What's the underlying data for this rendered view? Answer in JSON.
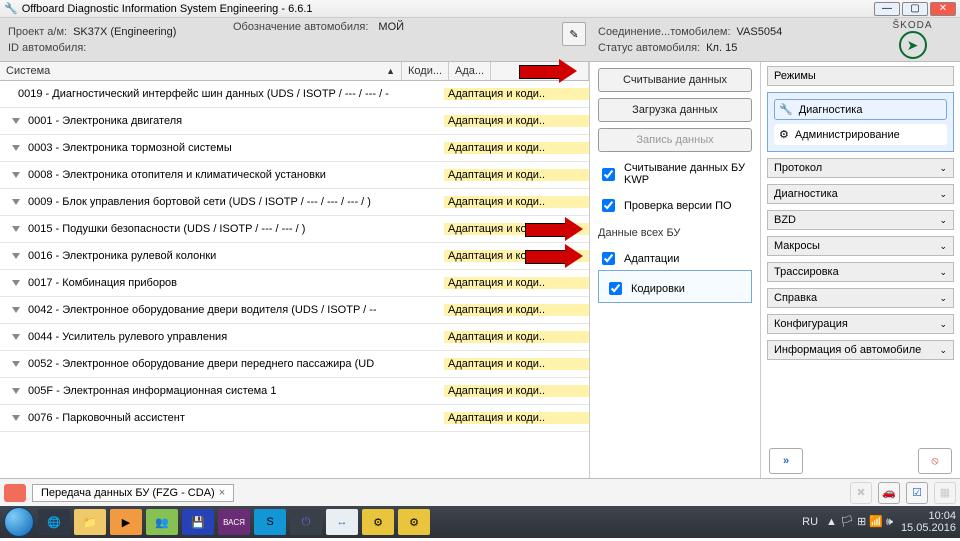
{
  "window": {
    "title": "Offboard Diagnostic Information System Engineering - 6.6.1",
    "min": "—",
    "max": "▢",
    "close": "✕"
  },
  "header": {
    "project_label": "Проект а/м:",
    "project_value": "SK37X      (Engineering)",
    "vehicle_id_label": "ID автомобиля:",
    "vehicle_id_value": "",
    "vehicle_alias_label": "Обозначение автомобиля:",
    "vehicle_alias_value": "МОЙ",
    "connection_label": "Соединение...томобилем:",
    "connection_value": "VAS5054",
    "status_label": "Статус автомобиля:",
    "status_value": "Кл. 15",
    "brand": "ŠKODA"
  },
  "table": {
    "col_system": "Система",
    "col_cod": "Коди...",
    "col_adp": "Ада...",
    "adapt_text": "Адаптация и коди..",
    "rows": [
      "0019 - Диагностический интерфейс шин данных  (UDS / ISOTP / --- / --- / -",
      "0001 - Электроника двигателя",
      "0003 - Электроника тормозной системы",
      "0008 - Электроника отопителя и климатической установки",
      "0009 - Блок управления бортовой сети  (UDS / ISOTP / --- / --- / --- /   )",
      "0015 - Подушки безопасности  (UDS / ISOTP / --- / --- /   )",
      "0016 - Электроника рулевой колонки",
      "0017 - Комбинация приборов",
      "0042 - Электронное оборудование двери водителя  (UDS / ISOTP / --",
      "0044 - Усилитель рулевого управления",
      "0052 - Электронное оборудование двери переднего пассажира  (UD",
      "005F - Электронная информационная система 1",
      "0076 - Парковочный ассистент"
    ]
  },
  "actions": {
    "read": "Считывание данных",
    "load": "Загрузка данных",
    "save": "Запись данных",
    "chk_kwp": "Считывание данных БУ KWP",
    "chk_ver": "Проверка версии ПО",
    "group_title": "Данные всех БУ",
    "chk_adapt": "Адаптации",
    "chk_code": "Кодировки"
  },
  "sidebar": {
    "modes_title": "Режимы",
    "diag": "Диагностика",
    "admin": "Администрирование",
    "sections": {
      "protocol": "Протокол",
      "diagnostics": "Диагностика",
      "bzd": "BZD",
      "macros": "Макросы",
      "trace": "Трассировка",
      "help": "Справка",
      "config": "Конфигурация",
      "vehicle_info": "Информация об автомобиле"
    }
  },
  "tabs": {
    "label": "Передача данных БУ (FZG - CDA)"
  },
  "tray": {
    "lang": "RU",
    "time": "10:04",
    "date": "15.05.2016"
  }
}
